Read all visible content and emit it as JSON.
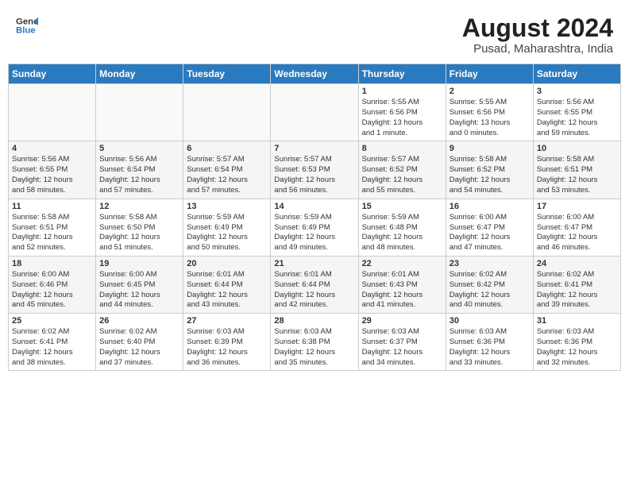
{
  "header": {
    "logo_line1": "General",
    "logo_line2": "Blue",
    "title": "August 2024",
    "subtitle": "Pusad, Maharashtra, India"
  },
  "weekdays": [
    "Sunday",
    "Monday",
    "Tuesday",
    "Wednesday",
    "Thursday",
    "Friday",
    "Saturday"
  ],
  "weeks": [
    [
      {
        "day": "",
        "info": ""
      },
      {
        "day": "",
        "info": ""
      },
      {
        "day": "",
        "info": ""
      },
      {
        "day": "",
        "info": ""
      },
      {
        "day": "1",
        "info": "Sunrise: 5:55 AM\nSunset: 6:56 PM\nDaylight: 13 hours\nand 1 minute."
      },
      {
        "day": "2",
        "info": "Sunrise: 5:55 AM\nSunset: 6:56 PM\nDaylight: 13 hours\nand 0 minutes."
      },
      {
        "day": "3",
        "info": "Sunrise: 5:56 AM\nSunset: 6:55 PM\nDaylight: 12 hours\nand 59 minutes."
      }
    ],
    [
      {
        "day": "4",
        "info": "Sunrise: 5:56 AM\nSunset: 6:55 PM\nDaylight: 12 hours\nand 58 minutes."
      },
      {
        "day": "5",
        "info": "Sunrise: 5:56 AM\nSunset: 6:54 PM\nDaylight: 12 hours\nand 57 minutes."
      },
      {
        "day": "6",
        "info": "Sunrise: 5:57 AM\nSunset: 6:54 PM\nDaylight: 12 hours\nand 57 minutes."
      },
      {
        "day": "7",
        "info": "Sunrise: 5:57 AM\nSunset: 6:53 PM\nDaylight: 12 hours\nand 56 minutes."
      },
      {
        "day": "8",
        "info": "Sunrise: 5:57 AM\nSunset: 6:52 PM\nDaylight: 12 hours\nand 55 minutes."
      },
      {
        "day": "9",
        "info": "Sunrise: 5:58 AM\nSunset: 6:52 PM\nDaylight: 12 hours\nand 54 minutes."
      },
      {
        "day": "10",
        "info": "Sunrise: 5:58 AM\nSunset: 6:51 PM\nDaylight: 12 hours\nand 53 minutes."
      }
    ],
    [
      {
        "day": "11",
        "info": "Sunrise: 5:58 AM\nSunset: 6:51 PM\nDaylight: 12 hours\nand 52 minutes."
      },
      {
        "day": "12",
        "info": "Sunrise: 5:58 AM\nSunset: 6:50 PM\nDaylight: 12 hours\nand 51 minutes."
      },
      {
        "day": "13",
        "info": "Sunrise: 5:59 AM\nSunset: 6:49 PM\nDaylight: 12 hours\nand 50 minutes."
      },
      {
        "day": "14",
        "info": "Sunrise: 5:59 AM\nSunset: 6:49 PM\nDaylight: 12 hours\nand 49 minutes."
      },
      {
        "day": "15",
        "info": "Sunrise: 5:59 AM\nSunset: 6:48 PM\nDaylight: 12 hours\nand 48 minutes."
      },
      {
        "day": "16",
        "info": "Sunrise: 6:00 AM\nSunset: 6:47 PM\nDaylight: 12 hours\nand 47 minutes."
      },
      {
        "day": "17",
        "info": "Sunrise: 6:00 AM\nSunset: 6:47 PM\nDaylight: 12 hours\nand 46 minutes."
      }
    ],
    [
      {
        "day": "18",
        "info": "Sunrise: 6:00 AM\nSunset: 6:46 PM\nDaylight: 12 hours\nand 45 minutes."
      },
      {
        "day": "19",
        "info": "Sunrise: 6:00 AM\nSunset: 6:45 PM\nDaylight: 12 hours\nand 44 minutes."
      },
      {
        "day": "20",
        "info": "Sunrise: 6:01 AM\nSunset: 6:44 PM\nDaylight: 12 hours\nand 43 minutes."
      },
      {
        "day": "21",
        "info": "Sunrise: 6:01 AM\nSunset: 6:44 PM\nDaylight: 12 hours\nand 42 minutes."
      },
      {
        "day": "22",
        "info": "Sunrise: 6:01 AM\nSunset: 6:43 PM\nDaylight: 12 hours\nand 41 minutes."
      },
      {
        "day": "23",
        "info": "Sunrise: 6:02 AM\nSunset: 6:42 PM\nDaylight: 12 hours\nand 40 minutes."
      },
      {
        "day": "24",
        "info": "Sunrise: 6:02 AM\nSunset: 6:41 PM\nDaylight: 12 hours\nand 39 minutes."
      }
    ],
    [
      {
        "day": "25",
        "info": "Sunrise: 6:02 AM\nSunset: 6:41 PM\nDaylight: 12 hours\nand 38 minutes."
      },
      {
        "day": "26",
        "info": "Sunrise: 6:02 AM\nSunset: 6:40 PM\nDaylight: 12 hours\nand 37 minutes."
      },
      {
        "day": "27",
        "info": "Sunrise: 6:03 AM\nSunset: 6:39 PM\nDaylight: 12 hours\nand 36 minutes."
      },
      {
        "day": "28",
        "info": "Sunrise: 6:03 AM\nSunset: 6:38 PM\nDaylight: 12 hours\nand 35 minutes."
      },
      {
        "day": "29",
        "info": "Sunrise: 6:03 AM\nSunset: 6:37 PM\nDaylight: 12 hours\nand 34 minutes."
      },
      {
        "day": "30",
        "info": "Sunrise: 6:03 AM\nSunset: 6:36 PM\nDaylight: 12 hours\nand 33 minutes."
      },
      {
        "day": "31",
        "info": "Sunrise: 6:03 AM\nSunset: 6:36 PM\nDaylight: 12 hours\nand 32 minutes."
      }
    ]
  ]
}
